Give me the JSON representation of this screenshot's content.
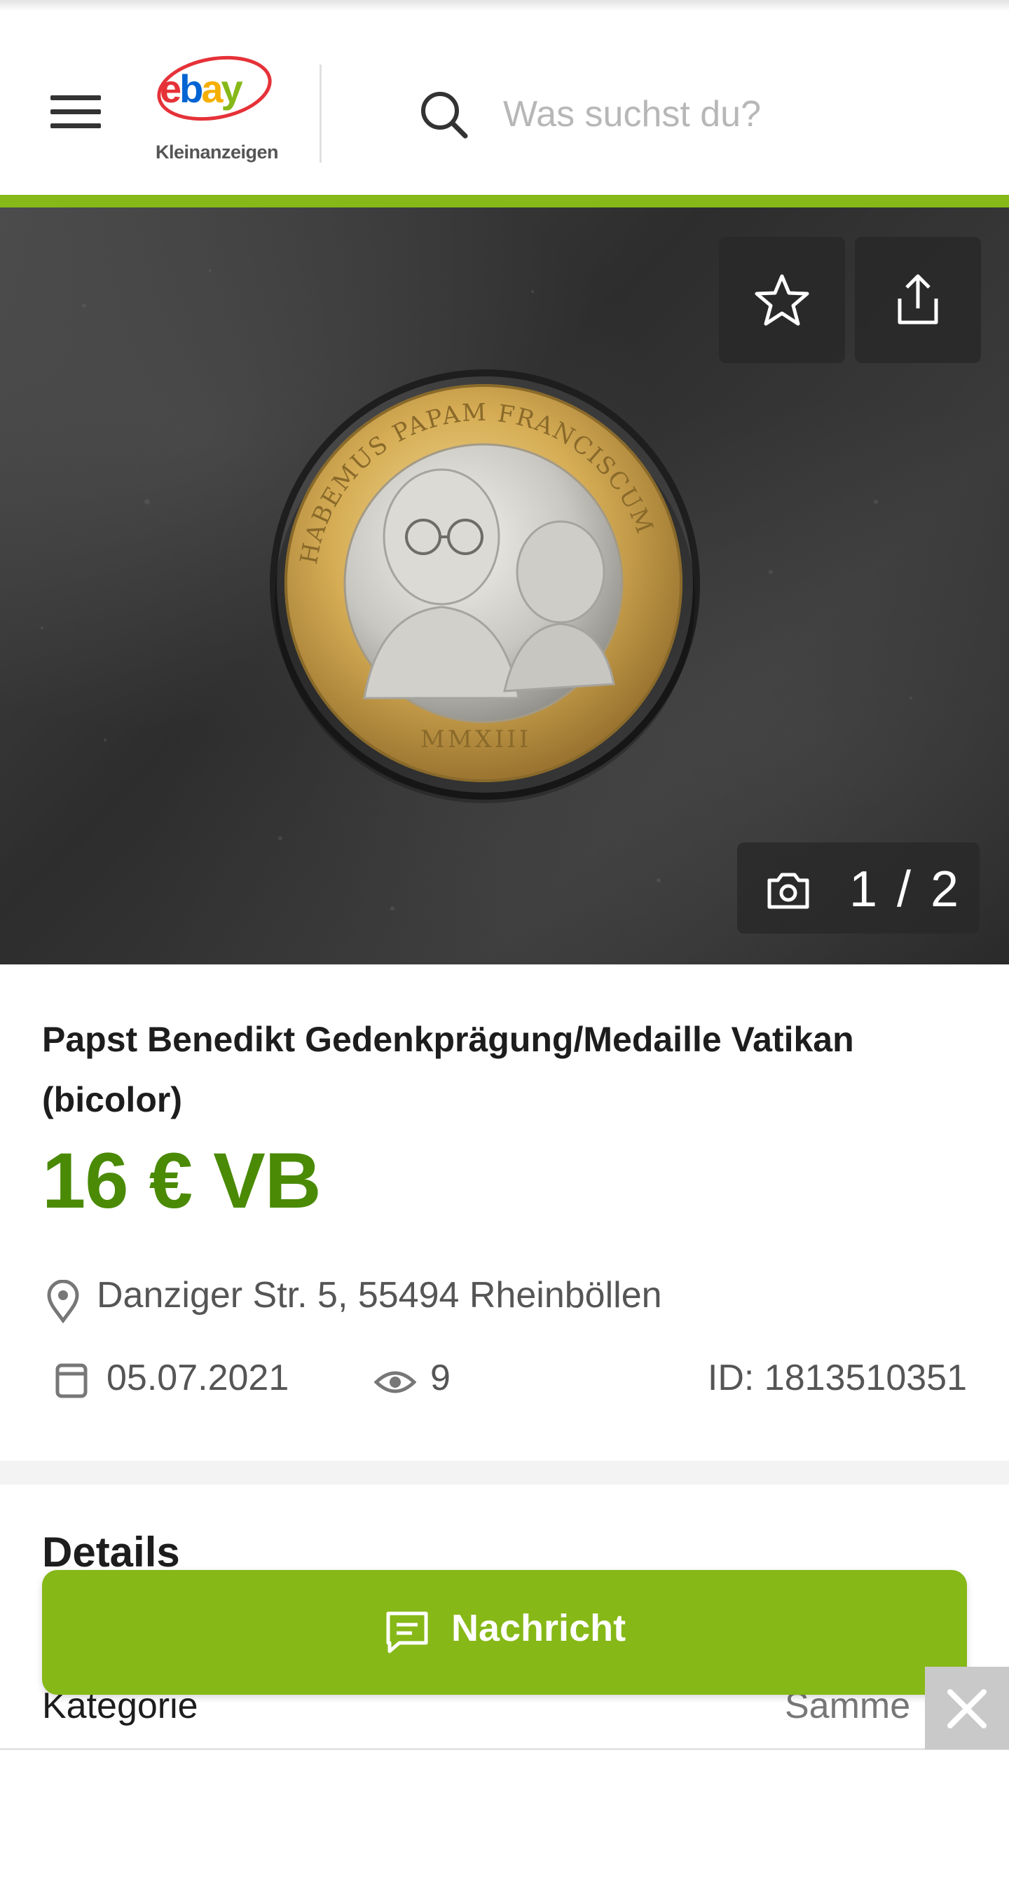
{
  "header": {
    "logo_text": "ebay",
    "logo_sub": "Kleinanzeigen",
    "search_placeholder": "Was suchst du?"
  },
  "gallery": {
    "counter": "1 / 2",
    "coin_inscription": "HABEMUS PAPAM FRANCISCUM",
    "coin_year": "MMXIII"
  },
  "listing": {
    "title": "Papst Benedikt Gedenkprägung/Medaille Vatikan (bicolor)",
    "price": "16 € VB",
    "location": "Danziger Str. 5, 55494 Rheinböllen",
    "date": "05.07.2021",
    "views": "9",
    "ad_id": "ID: 1813510351"
  },
  "details": {
    "heading": "Details",
    "category_label": "Kategorie",
    "category_value": "Samme"
  },
  "cta": {
    "label": "Nachricht"
  },
  "colors": {
    "brand_green": "#86b817",
    "price_green": "#4a8a05"
  }
}
